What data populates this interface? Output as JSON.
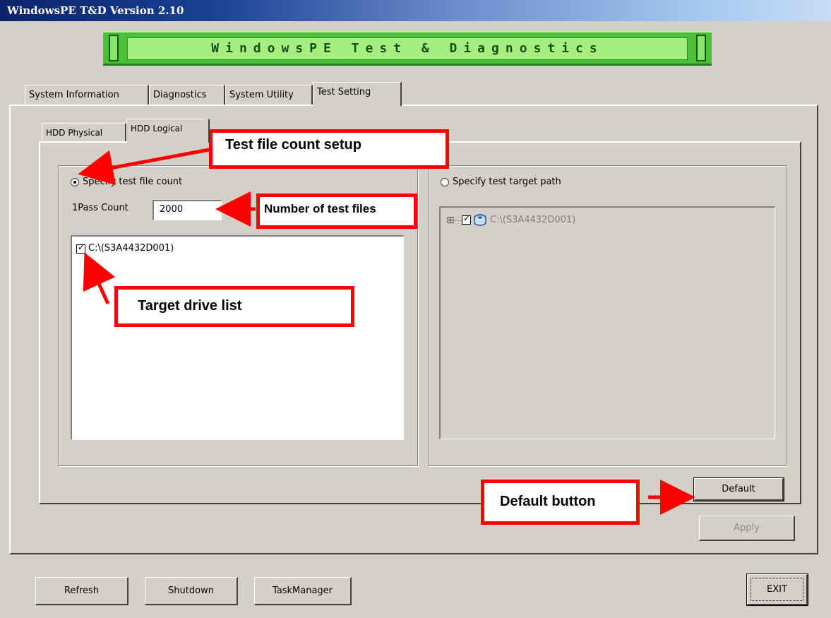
{
  "window": {
    "title": "WindowsPE T&D Version 2.10"
  },
  "banner": {
    "text": "WindowsPE Test & Diagnostics"
  },
  "main_tabs": [
    {
      "label": "System Information"
    },
    {
      "label": "Diagnostics"
    },
    {
      "label": "System Utility"
    },
    {
      "label": "Test Setting",
      "active": true
    }
  ],
  "sub_tabs": [
    {
      "label": "HDD Physical"
    },
    {
      "label": "HDD Logical",
      "active": true
    }
  ],
  "left_group": {
    "radio_label": "Specify test file count",
    "radio_selected": true,
    "pass_count_label": "1Pass Count",
    "pass_count_value": "2000",
    "drive_list": [
      {
        "label": "C:\\(S3A4432D001)",
        "checked": true
      }
    ]
  },
  "right_group": {
    "radio_label": "Specify test target path",
    "radio_selected": false,
    "tree": [
      {
        "expander": "⊞",
        "label": "C:\\(S3A4432D001)",
        "checked": true,
        "icon": "disk-icon"
      }
    ]
  },
  "buttons": {
    "default": "Default",
    "apply": "Apply",
    "refresh": "Refresh",
    "shutdown": "Shutdown",
    "task_manager": "TaskManager",
    "exit": "EXIT"
  },
  "annotations": {
    "test_file_count": "Test file count setup",
    "number_of_files": "Number of test files",
    "target_drive_list": "Target drive list",
    "default_button": "Default button"
  },
  "colors": {
    "annotation_red": "#ff0000",
    "titlebar_blue": "#0a246a",
    "banner_green": "#4cc03a"
  }
}
